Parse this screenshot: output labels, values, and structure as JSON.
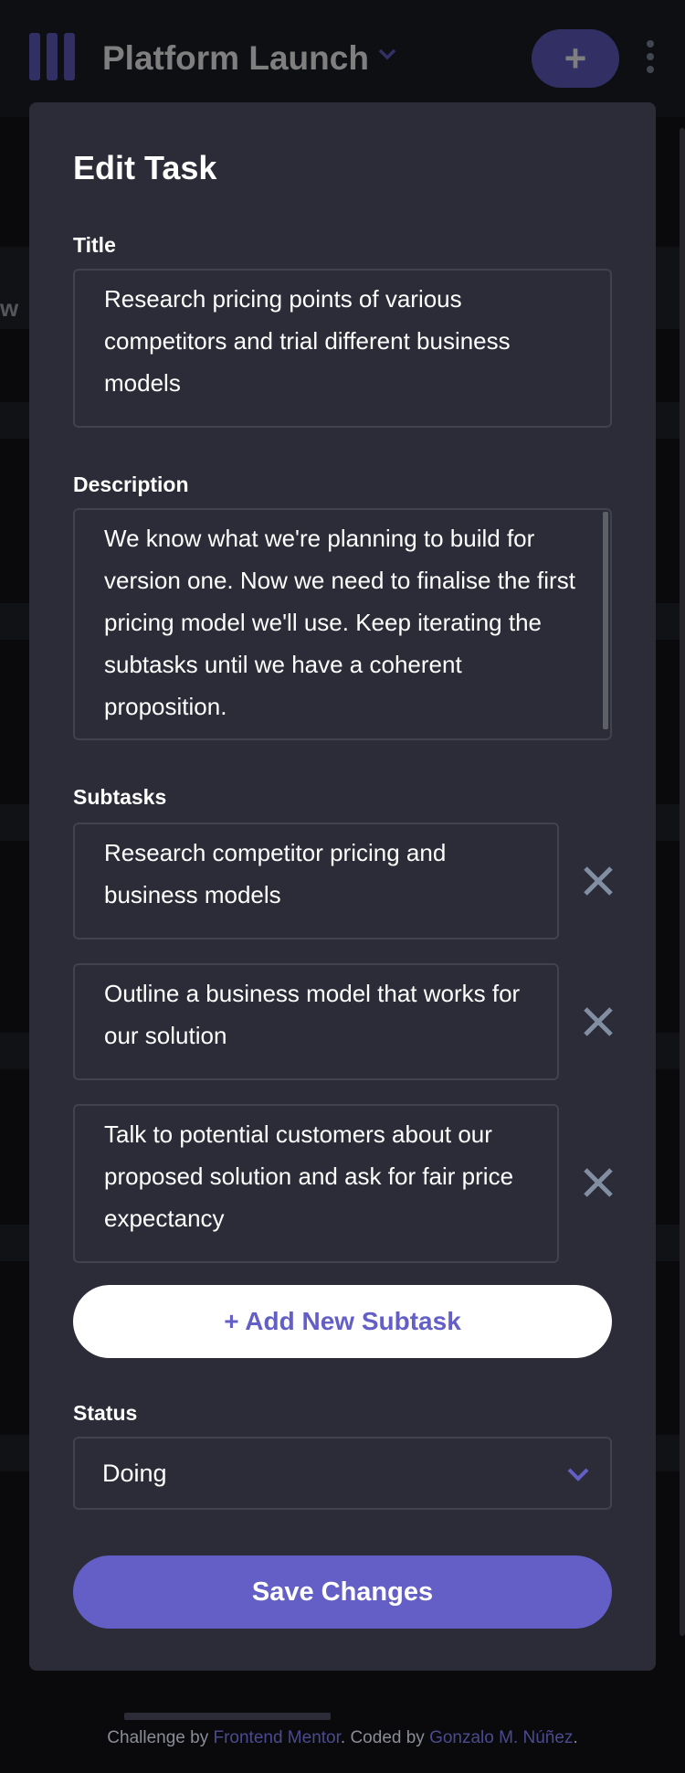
{
  "header": {
    "board_title": "Platform Launch",
    "add_task_label": "+",
    "bg_partial_text": "w"
  },
  "modal": {
    "title": "Edit Task",
    "title_label": "Title",
    "title_value": "Research pricing points of various competitors and trial different business models",
    "description_label": "Description",
    "description_value": "We know what we're planning to build for version one. Now we need to finalise the first pricing model we'll use. Keep iterating the subtasks until we have a coherent proposition.",
    "subtasks_label": "Subtasks",
    "subtasks": [
      "Research competitor pricing and business models",
      "Outline a business model that works for our solution",
      "Talk to potential customers about our proposed solution and ask for fair price expectancy"
    ],
    "add_subtask_label": "+ Add New Subtask",
    "status_label": "Status",
    "status_value": "Doing",
    "save_label": "Save Changes"
  },
  "footer": {
    "prefix": "Challenge by ",
    "challenge_link": "Frontend Mentor",
    "middle": ". Coded by ",
    "coder_link": "Gonzalo M. Núñez",
    "suffix": "."
  },
  "colors": {
    "accent": "#635fc7",
    "modal_bg": "#2b2c37",
    "page_bg": "#14151b",
    "icon_gray": "#828fa3"
  }
}
